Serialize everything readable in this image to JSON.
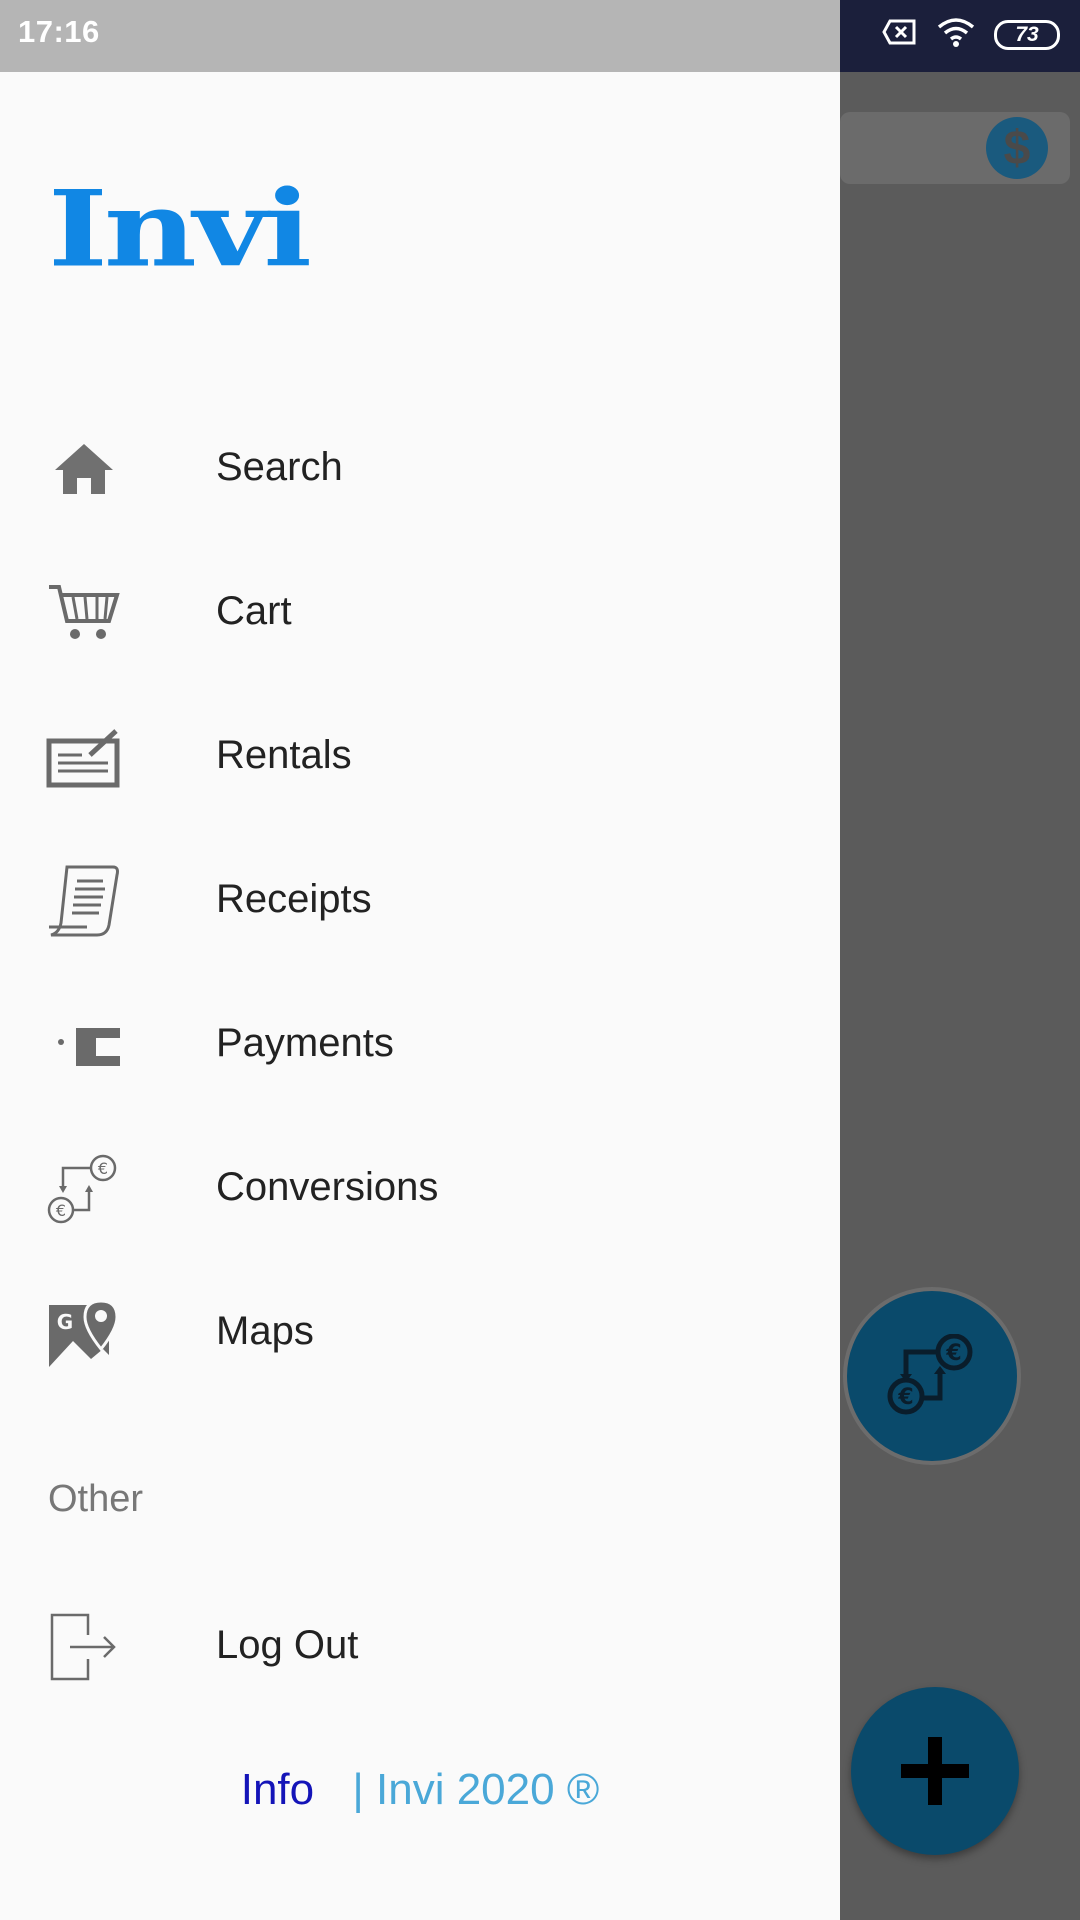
{
  "status_bar": {
    "time": "17:16",
    "battery": "73"
  },
  "drawer": {
    "logo": "Invi",
    "menu": [
      {
        "label": "Search",
        "icon": "home-icon"
      },
      {
        "label": "Cart",
        "icon": "cart-icon"
      },
      {
        "label": "Rentals",
        "icon": "rentals-icon"
      },
      {
        "label": "Receipts",
        "icon": "receipt-icon"
      },
      {
        "label": "Payments",
        "icon": "wallet-icon"
      },
      {
        "label": "Conversions",
        "icon": "currency-exchange-icon"
      },
      {
        "label": "Maps",
        "icon": "map-icon"
      }
    ],
    "section_other": "Other",
    "logout": {
      "label": "Log Out",
      "icon": "logout-icon"
    },
    "footer": {
      "info": "Info",
      "copyright": "| Invi 2020 ®"
    }
  },
  "colors": {
    "brand": "#1187e4",
    "info_link": "#1414b8",
    "copyright": "#4aa8d8",
    "scrim": "#5b5b5b"
  }
}
